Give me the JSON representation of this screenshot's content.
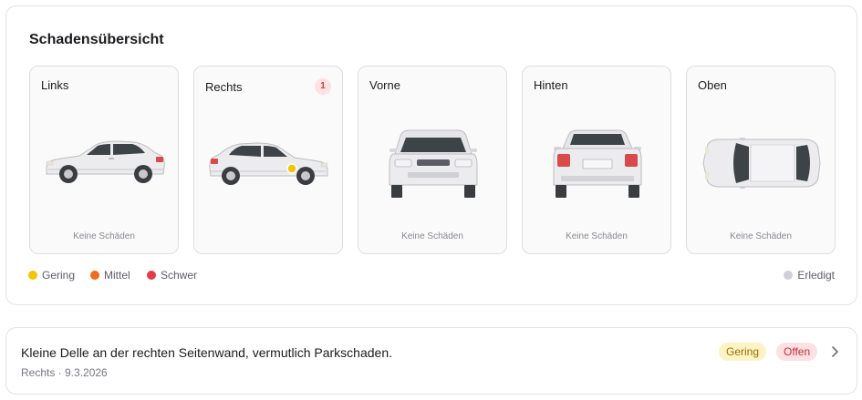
{
  "overview": {
    "title": "Schadensübersicht",
    "views": [
      {
        "label": "Links",
        "status": "Keine Schäden",
        "count": ""
      },
      {
        "label": "Rechts",
        "status": "",
        "count": "1"
      },
      {
        "label": "Vorne",
        "status": "Keine Schäden",
        "count": ""
      },
      {
        "label": "Hinten",
        "status": "Keine Schäden",
        "count": ""
      },
      {
        "label": "Oben",
        "status": "Keine Schäden",
        "count": ""
      }
    ],
    "legend": {
      "severity": [
        {
          "label": "Gering",
          "color": "#f5c400"
        },
        {
          "label": "Mittel",
          "color": "#f26b1d"
        },
        {
          "label": "Schwer",
          "color": "#e23b48"
        }
      ],
      "done": {
        "label": "Erledigt",
        "color": "#d0d0d8"
      }
    }
  },
  "damage": {
    "description": "Kleine Delle an der rechten Seitenwand, vermutlich Parkschaden.",
    "meta": "Rechts · 9.3.2026",
    "severity": "Gering",
    "status": "Offen",
    "marker_color": "#f5c400"
  }
}
